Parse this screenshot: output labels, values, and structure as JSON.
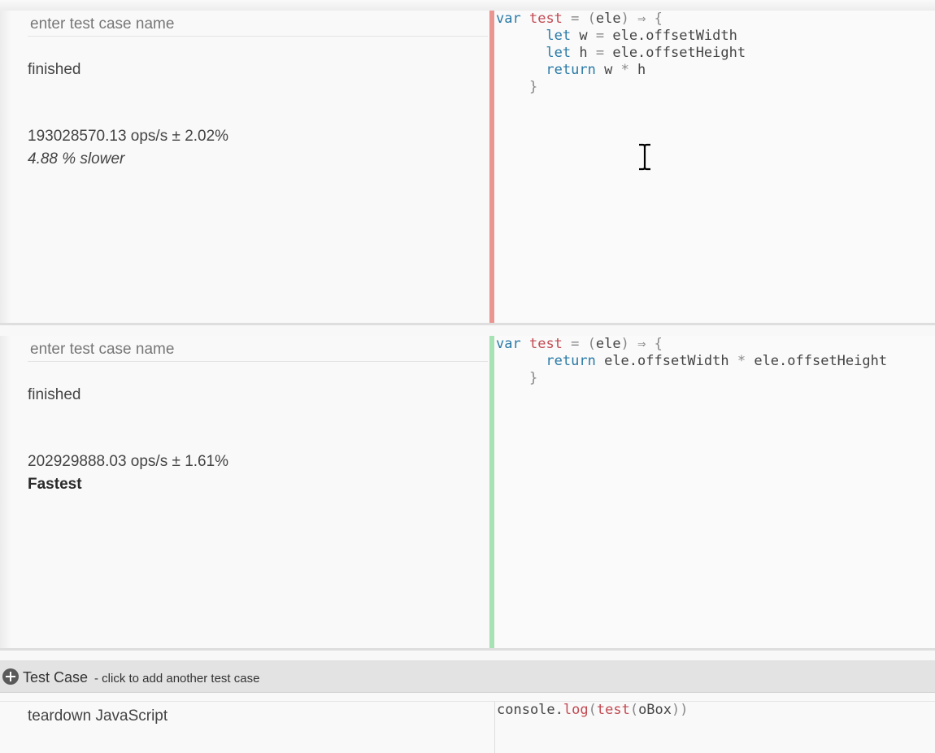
{
  "test_cases": [
    {
      "name_placeholder": "enter test case name",
      "status": "finished",
      "ops": "193028570.13 ops/s ± 2.02%",
      "relative": "4.88 % slower",
      "code_lines": [
        "var test = (ele) => {",
        "      let w = ele.offsetWidth",
        "      let h = ele.offsetHeight",
        "      return w * h",
        "    }"
      ]
    },
    {
      "name_placeholder": "enter test case name",
      "status": "finished",
      "ops": "202929888.03 ops/s ± 1.61%",
      "relative": "Fastest",
      "code_lines": [
        "var test = (ele) => {",
        "      return ele.offsetWidth * ele.offsetHeight",
        "    }"
      ]
    }
  ],
  "add_bar": {
    "title": "Test Case",
    "hint": "- click to add another test case",
    "icon": "plus-circle-icon"
  },
  "teardown": {
    "label": "teardown JavaScript",
    "code": "console.log(test(oBox))"
  },
  "colors": {
    "slower_bar": "#ea9590",
    "fastest_bar": "#a6e2b4",
    "keyword": "#2a7aa6",
    "variable": "#c24a52"
  }
}
